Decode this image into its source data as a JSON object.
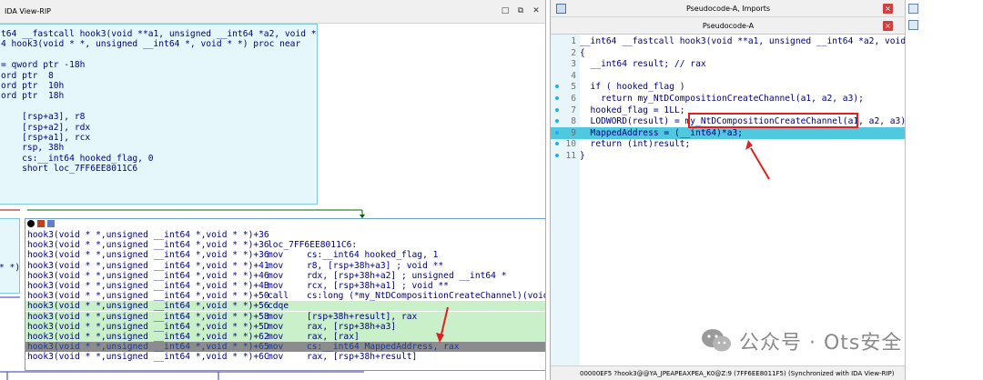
{
  "left_pane": {
    "title": "IDA View-RIP",
    "node1_lines": [
      "t64 __fastcall hook3(void **a1, unsigned __int64 *a2, void **a3)",
      "4 hook3(void * *, unsigned __int64 *, void * *) proc near",
      "",
      "= qword ptr -18h",
      "ord ptr  8",
      "ord ptr  10h",
      "ord ptr  18h",
      "",
      "    [rsp+a3], r8",
      "    [rsp+a2], rdx",
      "    [rsp+a1], rcx",
      "    rsp, 38h",
      "    cs:__int64 hooked_flag, 0",
      "    short loc_7FF6EE8011C6"
    ],
    "small_node_text": "* *)",
    "node2_rows": [
      {
        "name": "hook3(void * *,unsigned __int64 *,void * *)+36",
        "mn": "",
        "op": ""
      },
      {
        "name": "hook3(void * *,unsigned __int64 *,void * *)+36",
        "mn": "loc_7FF6EE8011C6:",
        "op": ""
      },
      {
        "name": "hook3(void * *,unsigned __int64 *,void * *)+36",
        "mn": "mov",
        "op": "cs:__int64 hooked_flag, 1"
      },
      {
        "name": "hook3(void * *,unsigned __int64 *,void * *)+41",
        "mn": "mov",
        "op": "r8, [rsp+38h+a3] ; void **"
      },
      {
        "name": "hook3(void * *,unsigned __int64 *,void * *)+46",
        "mn": "mov",
        "op": "rdx, [rsp+38h+a2] ; unsigned __int64 *"
      },
      {
        "name": "hook3(void * *,unsigned __int64 *,void * *)+4B",
        "mn": "mov",
        "op": "rcx, [rsp+38h+a1] ; void **"
      },
      {
        "name": "hook3(void * *,unsigned __int64 *,void * *)+50",
        "mn": "call",
        "op": "cs:long (*my_NtDCompositionCreateChannel)(void *"
      },
      {
        "name": "hook3(void * *,unsigned __int64 *,void * *)+56",
        "mn": "cdqe",
        "op": ""
      },
      {
        "name": "hook3(void * *,unsigned __int64 *,void * *)+58",
        "mn": "mov",
        "op": "[rsp+38h+result], rax"
      },
      {
        "name": "hook3(void * *,unsigned __int64 *,void * *)+5D",
        "mn": "mov",
        "op": "rax, [rsp+38h+a3]"
      },
      {
        "name": "hook3(void * *,unsigned __int64 *,void * *)+62",
        "mn": "mov",
        "op": "rax, [rax]"
      },
      {
        "name": "hook3(void * *,unsigned __int64 *,void * *)+65",
        "mn": "mov",
        "op": "cs:__int64 MappedAddress, rax"
      },
      {
        "name": "hook3(void * *,unsigned __int64 *,void * *)+6C",
        "mn": "mov",
        "op": "rax, [rsp+38h+result]"
      }
    ]
  },
  "right_pane": {
    "tab1_label": "Pseudocode-A, Imports",
    "tab2_label": "Pseudocode-A",
    "close_glyph": "×",
    "lines": [
      {
        "n": "1",
        "code": "__int64 __fastcall hook3(void **a1, unsigned __int64 *a2, void **a3)",
        "dot": false
      },
      {
        "n": "2",
        "code": "{",
        "dot": false
      },
      {
        "n": "3",
        "code": "  __int64 result; // rax",
        "dot": false
      },
      {
        "n": "4",
        "code": "",
        "dot": false
      },
      {
        "n": "5",
        "code": "  if ( hooked_flag )",
        "dot": true
      },
      {
        "n": "6",
        "code": "    return my_NtDCompositionCreateChannel(a1, a2, a3);",
        "dot": true
      },
      {
        "n": "7",
        "code": "  hooked_flag = 1LL;",
        "dot": true
      },
      {
        "n": "8",
        "code": "  LODWORD(result) = my_NtDCompositionCreateChannel(a1, a2, a3);",
        "dot": true
      },
      {
        "n": "9",
        "code": "  MappedAddress = (__int64)*a3;",
        "dot": true
      },
      {
        "n": "10",
        "code": "  return (int)result;",
        "dot": true
      },
      {
        "n": "11",
        "code": "}",
        "dot": true
      }
    ],
    "status": "00000EF5 ?hook3@@YA_JPEAPEAXPEA_K0@Z:9 (7FF6EE8011F5) (Synchronized with IDA View-RIP)"
  },
  "watermark": {
    "text": "公众号 · Ots安全"
  },
  "colors": {
    "accent_cyan": "#4fc8e0",
    "highlight_green": "#c9f0c9",
    "selected_gray": "#8c8c8c",
    "annotation_red": "#e02020"
  }
}
